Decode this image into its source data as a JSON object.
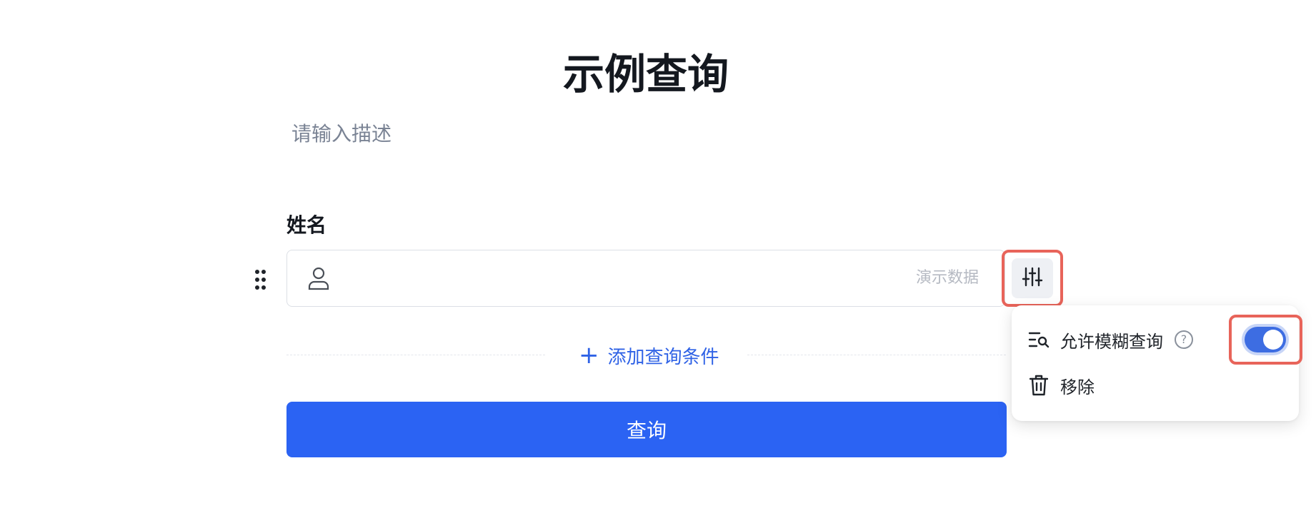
{
  "form": {
    "title": "示例查询",
    "description_placeholder": "请输入描述"
  },
  "field": {
    "label": "姓名",
    "icon": "person-icon",
    "value": "",
    "tag": "演示数据",
    "settings_icon": "sliders-icon"
  },
  "actions": {
    "add_condition": "添加查询条件",
    "add_icon": "plus-icon",
    "query": "查询"
  },
  "popover": {
    "fuzzy_label": "允许模糊查询",
    "fuzzy_icon": "search-list-icon",
    "help_icon": "question-circle-icon",
    "help_glyph": "?",
    "fuzzy_enabled": true,
    "remove_label": "移除",
    "remove_icon": "trash-icon"
  },
  "colors": {
    "primary": "#2b63f3",
    "link": "#2f62e6",
    "highlight": "#e8645a",
    "toggle_on": "#3d6de2"
  }
}
